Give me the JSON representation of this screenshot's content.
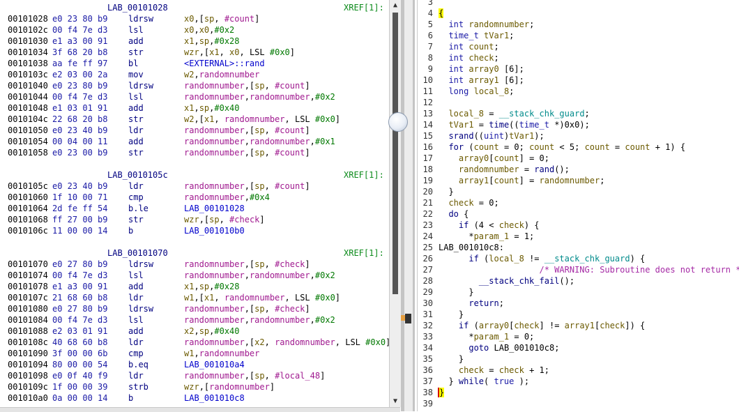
{
  "listing": {
    "rows": [
      {
        "type": "label",
        "label": "LAB_00101028",
        "xref": "XREF[1]:"
      },
      {
        "type": "insn",
        "addr": "00101028",
        "bytes": "e0 23 80 b9",
        "mnemonic": "ldrsw",
        "ops": "x0,[sp, #count]"
      },
      {
        "type": "insn",
        "addr": "0010102c",
        "bytes": "00 f4 7e d3",
        "mnemonic": "lsl",
        "ops": "x0,x0,#0x2"
      },
      {
        "type": "insn",
        "addr": "00101030",
        "bytes": "e1 a3 00 91",
        "mnemonic": "add",
        "ops": "x1,sp,#0x28"
      },
      {
        "type": "insn",
        "addr": "00101034",
        "bytes": "3f 68 20 b8",
        "mnemonic": "str",
        "ops": "wzr,[x1, x0, LSL #0x0]"
      },
      {
        "type": "insn",
        "addr": "00101038",
        "bytes": "aa fe ff 97",
        "mnemonic": "bl",
        "ops": "<EXTERNAL>::rand"
      },
      {
        "type": "insn",
        "addr": "0010103c",
        "bytes": "e2 03 00 2a",
        "mnemonic": "mov",
        "ops": "w2,randomnumber"
      },
      {
        "type": "insn",
        "addr": "00101040",
        "bytes": "e0 23 80 b9",
        "mnemonic": "ldrsw",
        "ops": "randomnumber,[sp, #count]"
      },
      {
        "type": "insn",
        "addr": "00101044",
        "bytes": "00 f4 7e d3",
        "mnemonic": "lsl",
        "ops": "randomnumber,randomnumber,#0x2"
      },
      {
        "type": "insn",
        "addr": "00101048",
        "bytes": "e1 03 01 91",
        "mnemonic": "add",
        "ops": "x1,sp,#0x40"
      },
      {
        "type": "insn",
        "addr": "0010104c",
        "bytes": "22 68 20 b8",
        "mnemonic": "str",
        "ops": "w2,[x1, randomnumber, LSL #0x0]"
      },
      {
        "type": "insn",
        "addr": "00101050",
        "bytes": "e0 23 40 b9",
        "mnemonic": "ldr",
        "ops": "randomnumber,[sp, #count]"
      },
      {
        "type": "insn",
        "addr": "00101054",
        "bytes": "00 04 00 11",
        "mnemonic": "add",
        "ops": "randomnumber,randomnumber,#0x1"
      },
      {
        "type": "insn",
        "addr": "00101058",
        "bytes": "e0 23 00 b9",
        "mnemonic": "str",
        "ops": "randomnumber,[sp, #count]"
      },
      {
        "type": "blank"
      },
      {
        "type": "label",
        "label": "LAB_0010105c",
        "xref": "XREF[1]:"
      },
      {
        "type": "insn",
        "addr": "0010105c",
        "bytes": "e0 23 40 b9",
        "mnemonic": "ldr",
        "ops": "randomnumber,[sp, #count]"
      },
      {
        "type": "insn",
        "addr": "00101060",
        "bytes": "1f 10 00 71",
        "mnemonic": "cmp",
        "ops": "randomnumber,#0x4"
      },
      {
        "type": "insn",
        "addr": "00101064",
        "bytes": "2d fe ff 54",
        "mnemonic": "b.le",
        "ops": "LAB_00101028"
      },
      {
        "type": "insn",
        "addr": "00101068",
        "bytes": "ff 27 00 b9",
        "mnemonic": "str",
        "ops": "wzr,[sp, #check]"
      },
      {
        "type": "insn",
        "addr": "0010106c",
        "bytes": "11 00 00 14",
        "mnemonic": "b",
        "ops": "LAB_001010b0"
      },
      {
        "type": "blank"
      },
      {
        "type": "label",
        "label": "LAB_00101070",
        "xref": "XREF[1]:"
      },
      {
        "type": "insn",
        "addr": "00101070",
        "bytes": "e0 27 80 b9",
        "mnemonic": "ldrsw",
        "ops": "randomnumber,[sp, #check]"
      },
      {
        "type": "insn",
        "addr": "00101074",
        "bytes": "00 f4 7e d3",
        "mnemonic": "lsl",
        "ops": "randomnumber,randomnumber,#0x2"
      },
      {
        "type": "insn",
        "addr": "00101078",
        "bytes": "e1 a3 00 91",
        "mnemonic": "add",
        "ops": "x1,sp,#0x28"
      },
      {
        "type": "insn",
        "addr": "0010107c",
        "bytes": "21 68 60 b8",
        "mnemonic": "ldr",
        "ops": "w1,[x1, randomnumber, LSL #0x0]"
      },
      {
        "type": "insn",
        "addr": "00101080",
        "bytes": "e0 27 80 b9",
        "mnemonic": "ldrsw",
        "ops": "randomnumber,[sp, #check]"
      },
      {
        "type": "insn",
        "addr": "00101084",
        "bytes": "00 f4 7e d3",
        "mnemonic": "lsl",
        "ops": "randomnumber,randomnumber,#0x2"
      },
      {
        "type": "insn",
        "addr": "00101088",
        "bytes": "e2 03 01 91",
        "mnemonic": "add",
        "ops": "x2,sp,#0x40"
      },
      {
        "type": "insn",
        "addr": "0010108c",
        "bytes": "40 68 60 b8",
        "mnemonic": "ldr",
        "ops": "randomnumber,[x2, randomnumber, LSL #0x0]"
      },
      {
        "type": "insn",
        "addr": "00101090",
        "bytes": "3f 00 00 6b",
        "mnemonic": "cmp",
        "ops": "w1,randomnumber"
      },
      {
        "type": "insn",
        "addr": "00101094",
        "bytes": "80 00 00 54",
        "mnemonic": "b.eq",
        "ops": "LAB_001010a4"
      },
      {
        "type": "insn",
        "addr": "00101098",
        "bytes": "e0 0f 40 f9",
        "mnemonic": "ldr",
        "ops": "randomnumber,[sp, #local_48]"
      },
      {
        "type": "insn",
        "addr": "0010109c",
        "bytes": "1f 00 00 39",
        "mnemonic": "strb",
        "ops": "wzr,[randomnumber]"
      },
      {
        "type": "insn",
        "addr": "001010a0",
        "bytes": "0a 00 00 14",
        "mnemonic": "b",
        "ops": "LAB_001010c8"
      }
    ]
  },
  "decompiler": {
    "lines": [
      {
        "n": "3",
        "code": ""
      },
      {
        "n": "4",
        "code": "{"
      },
      {
        "n": "5",
        "code": "  int randomnumber;"
      },
      {
        "n": "6",
        "code": "  time_t tVar1;"
      },
      {
        "n": "7",
        "code": "  int count;"
      },
      {
        "n": "8",
        "code": "  int check;"
      },
      {
        "n": "9",
        "code": "  int array0 [6];"
      },
      {
        "n": "10",
        "code": "  int array1 [6];"
      },
      {
        "n": "11",
        "code": "  long local_8;"
      },
      {
        "n": "12",
        "code": ""
      },
      {
        "n": "13",
        "code": "  local_8 = __stack_chk_guard;"
      },
      {
        "n": "14",
        "code": "  tVar1 = time((time_t *)0x0);"
      },
      {
        "n": "15",
        "code": "  srand((uint)tVar1);"
      },
      {
        "n": "16",
        "code": "  for (count = 0; count < 5; count = count + 1) {"
      },
      {
        "n": "17",
        "code": "    array0[count] = 0;"
      },
      {
        "n": "18",
        "code": "    randomnumber = rand();"
      },
      {
        "n": "19",
        "code": "    array1[count] = randomnumber;"
      },
      {
        "n": "20",
        "code": "  }"
      },
      {
        "n": "21",
        "code": "  check = 0;"
      },
      {
        "n": "22",
        "code": "  do {"
      },
      {
        "n": "23",
        "code": "    if (4 < check) {"
      },
      {
        "n": "24",
        "code": "      *param_1 = 1;"
      },
      {
        "n": "25",
        "code": "LAB_001010c8:"
      },
      {
        "n": "26",
        "code": "      if (local_8 != __stack_chk_guard) {"
      },
      {
        "n": "27",
        "code": "                    /* WARNING: Subroutine does not return */"
      },
      {
        "n": "28",
        "code": "        __stack_chk_fail();"
      },
      {
        "n": "29",
        "code": "      }"
      },
      {
        "n": "30",
        "code": "      return;"
      },
      {
        "n": "31",
        "code": "    }"
      },
      {
        "n": "32",
        "code": "    if (array0[check] != array1[check]) {"
      },
      {
        "n": "33",
        "code": "      *param_1 = 0;"
      },
      {
        "n": "34",
        "code": "      goto LAB_001010c8;"
      },
      {
        "n": "35",
        "code": "    }"
      },
      {
        "n": "36",
        "code": "    check = check + 1;"
      },
      {
        "n": "37",
        "code": "  } while( true );"
      },
      {
        "n": "38",
        "code": "}"
      },
      {
        "n": "39",
        "code": ""
      }
    ]
  },
  "colors": {
    "register": "#6b5a00",
    "variable": "#a0198f",
    "number": "#007800",
    "keyword": "#000080",
    "type": "#1a1aa6",
    "global": "#008b8b",
    "comment": "#a52aa5",
    "xref": "#0b8a1a"
  },
  "icons": {
    "scroll_up": "up-triangle",
    "scroll_down": "down-triangle",
    "split_handle": "round-knob"
  }
}
